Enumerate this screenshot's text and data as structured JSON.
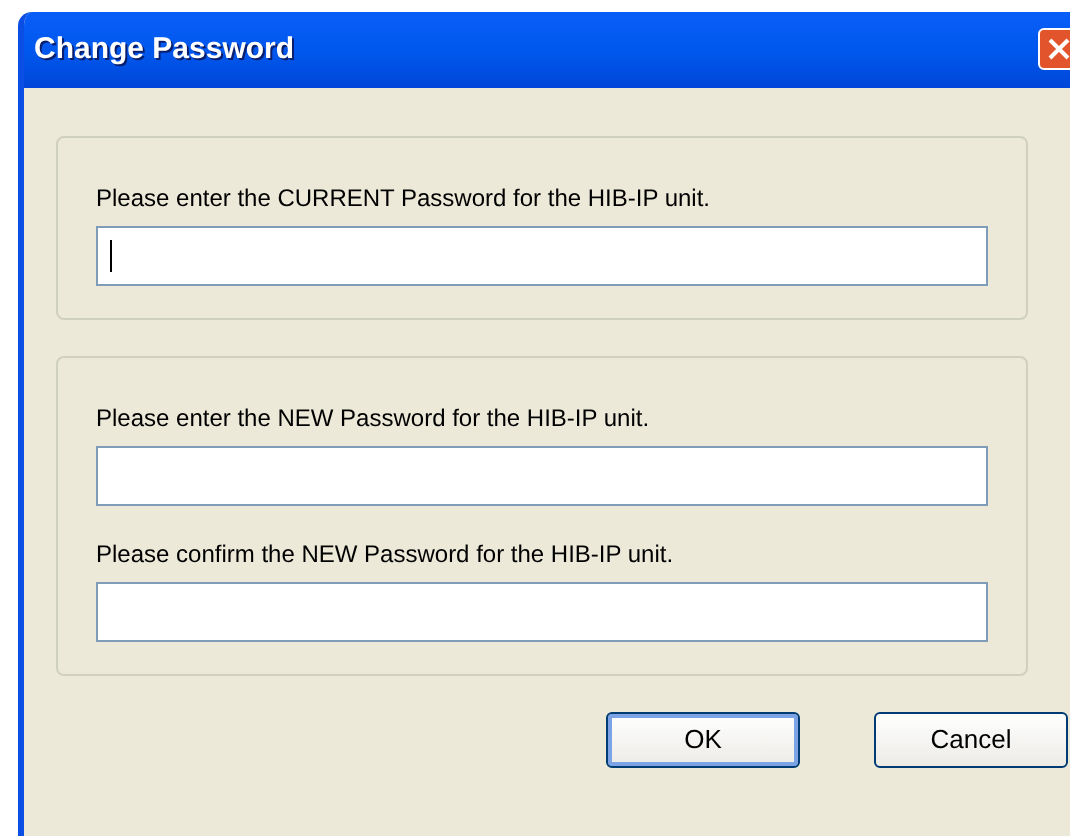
{
  "window": {
    "title": "Change Password"
  },
  "groups": [
    {
      "fields": [
        {
          "label": "Please enter the CURRENT Password for the HIB-IP unit.",
          "focused": true
        }
      ]
    },
    {
      "fields": [
        {
          "label": "Please enter the NEW Password for the HIB-IP unit.",
          "focused": false
        },
        {
          "label": "Please confirm the NEW Password for the HIB-IP unit.",
          "focused": false
        }
      ]
    }
  ],
  "buttons": [
    {
      "label": "OK",
      "default": true
    },
    {
      "label": "Cancel",
      "default": false
    }
  ]
}
